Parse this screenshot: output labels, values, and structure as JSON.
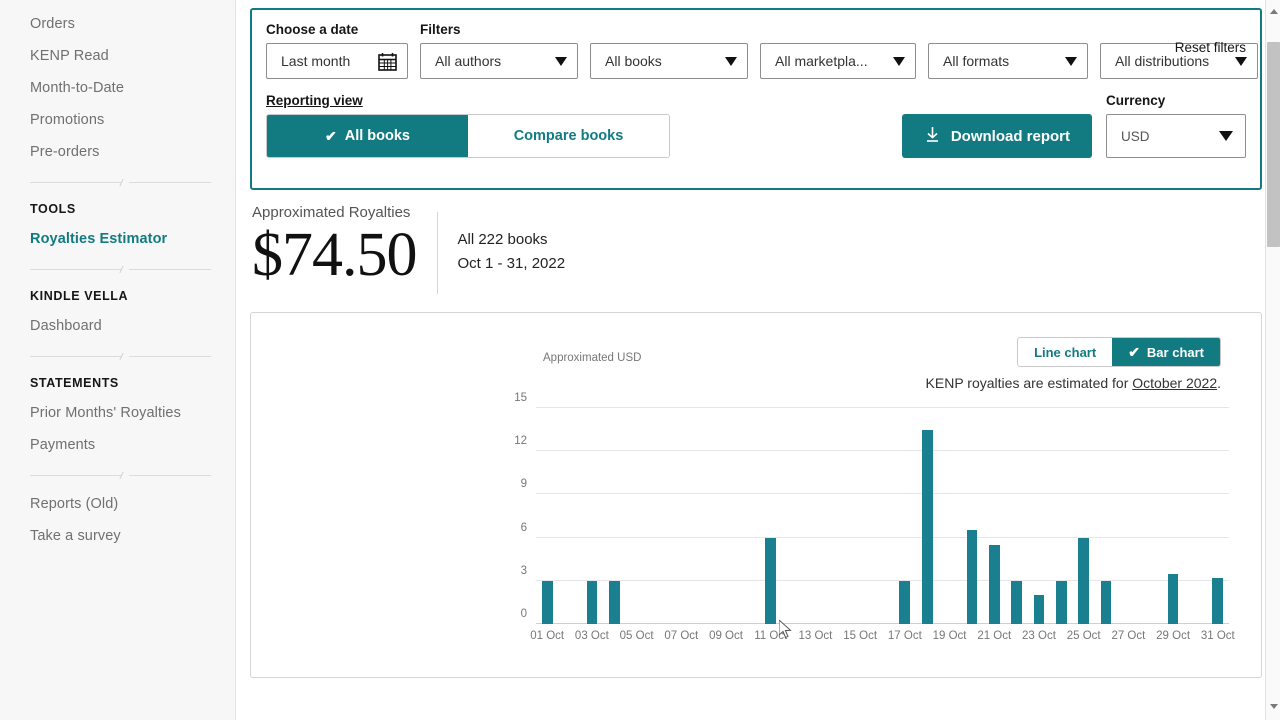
{
  "sidebar": {
    "items": [
      {
        "label": "Orders",
        "type": "link",
        "active": false
      },
      {
        "label": "KENP Read",
        "type": "link",
        "active": false
      },
      {
        "label": "Month-to-Date",
        "type": "link",
        "active": false
      },
      {
        "label": "Promotions",
        "type": "link",
        "active": false
      },
      {
        "label": "Pre-orders",
        "type": "link",
        "active": false
      }
    ],
    "tools_heading": "TOOLS",
    "tools_items": [
      {
        "label": "Royalties Estimator",
        "active": true
      }
    ],
    "vella_heading": "KINDLE VELLA",
    "vella_items": [
      {
        "label": "Dashboard",
        "active": false
      }
    ],
    "statements_heading": "STATEMENTS",
    "statements_items": [
      {
        "label": "Prior Months' Royalties",
        "active": false
      },
      {
        "label": "Payments",
        "active": false
      }
    ],
    "footer_items": [
      {
        "label": "Reports (Old)",
        "active": false
      },
      {
        "label": "Take a survey",
        "active": false
      }
    ]
  },
  "filters": {
    "date_label": "Choose a date",
    "date_value": "Last month",
    "filters_label": "Filters",
    "reset_label": "Reset filters",
    "dropdowns": [
      {
        "name": "authors",
        "value": "All authors"
      },
      {
        "name": "books",
        "value": "All books"
      },
      {
        "name": "marketplaces",
        "value": "All marketpla..."
      },
      {
        "name": "formats",
        "value": "All formats"
      },
      {
        "name": "distributions",
        "value": "All distributions"
      }
    ],
    "reporting_view_label": "Reporting view",
    "view_tabs": [
      {
        "label": "All books",
        "active": true
      },
      {
        "label": "Compare books",
        "active": false
      }
    ],
    "download_label": "Download report",
    "currency_label": "Currency",
    "currency_value": "USD",
    "accent_color": "#127b82"
  },
  "summary": {
    "title": "Approximated Royalties",
    "amount": "$74.50",
    "books_line": "All 222 books",
    "date_line": "Oct 1 - 31, 2022"
  },
  "chart_panel": {
    "toggle": [
      {
        "label": "Line chart",
        "active": false
      },
      {
        "label": "Bar chart",
        "active": true
      }
    ],
    "note_prefix": "KENP royalties are estimated for ",
    "note_link": "October 2022",
    "note_suffix": "."
  },
  "chart_data": {
    "type": "bar",
    "title": "",
    "ylabel": "Approximated USD",
    "xlabel": "",
    "ylim": [
      0,
      15
    ],
    "yticks": [
      0,
      3,
      6,
      9,
      12,
      15
    ],
    "grid": true,
    "legend": "none",
    "bar_color": "#1a7f8e",
    "categories": [
      "01 Oct",
      "02 Oct",
      "03 Oct",
      "04 Oct",
      "05 Oct",
      "06 Oct",
      "07 Oct",
      "08 Oct",
      "09 Oct",
      "10 Oct",
      "11 Oct",
      "12 Oct",
      "13 Oct",
      "14 Oct",
      "15 Oct",
      "16 Oct",
      "17 Oct",
      "18 Oct",
      "19 Oct",
      "20 Oct",
      "21 Oct",
      "22 Oct",
      "23 Oct",
      "24 Oct",
      "25 Oct",
      "26 Oct",
      "27 Oct",
      "28 Oct",
      "29 Oct",
      "30 Oct",
      "31 Oct"
    ],
    "tick_labels": [
      "01 Oct",
      "03 Oct",
      "05 Oct",
      "07 Oct",
      "09 Oct",
      "11 Oct",
      "13 Oct",
      "15 Oct",
      "17 Oct",
      "19 Oct",
      "21 Oct",
      "23 Oct",
      "25 Oct",
      "27 Oct",
      "29 Oct",
      "31 Oct"
    ],
    "values": [
      3.0,
      0,
      3.0,
      3.0,
      0,
      0,
      0,
      0,
      0,
      0,
      6.0,
      0,
      0,
      0,
      0,
      0,
      3.0,
      13.5,
      0,
      6.5,
      5.5,
      3.0,
      2.0,
      3.0,
      6.0,
      3.0,
      0,
      0,
      3.5,
      0,
      3.2
    ]
  },
  "scrollbar": {
    "name": "vertical-scrollbar"
  }
}
